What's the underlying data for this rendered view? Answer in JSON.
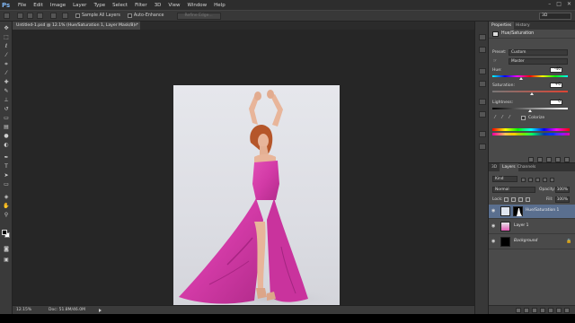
{
  "menubar": {
    "logo": "Ps",
    "items": [
      "File",
      "Edit",
      "Image",
      "Layer",
      "Type",
      "Select",
      "Filter",
      "3D",
      "View",
      "Window",
      "Help"
    ],
    "window_controls": [
      "–",
      "□",
      "✕"
    ]
  },
  "optionsbar": {
    "sample_all_layers": "Sample All Layers",
    "auto_enhance": "Auto-Enhance",
    "refine_edge": "Refine Edge...",
    "workspace": "3D"
  },
  "document": {
    "tab_title": "Untitled-1.psd @ 12.1% (Hue/Saturation 1, Layer Mask/8) *",
    "tab_close": "×"
  },
  "statusbar": {
    "zoom": "12.15%",
    "doc_size": "Doc: 51.8M/46.0M"
  },
  "properties": {
    "tabs": [
      "Properties",
      "History"
    ],
    "title": "Hue/Saturation",
    "preset_label": "Preset:",
    "preset_value": "Custom",
    "channel_value": "Master",
    "hue_label": "Hue:",
    "hue_value": "-46",
    "saturation_label": "Saturation:",
    "saturation_value": "+6",
    "lightness_label": "Lightness:",
    "lightness_value": "0",
    "colorize_label": "Colorize",
    "levels": {
      "hue": 0.38,
      "saturation": 0.52,
      "lightness": 0.5
    }
  },
  "layers": {
    "tabs": [
      "3D",
      "Layers",
      "Channels"
    ],
    "kind_filter": "Kind",
    "blend_mode": "Normal",
    "opacity_label": "Opacity:",
    "opacity_value": "100%",
    "lock_label": "Lock:",
    "fill_label": "Fill:",
    "fill_value": "100%",
    "items": [
      {
        "name": "Hue/Saturation 1",
        "selected": true
      },
      {
        "name": "Layer 1",
        "selected": false
      },
      {
        "name": "Background",
        "selected": false
      }
    ]
  },
  "colors": {
    "dress": "#d63aa8",
    "selection": "#5a6f8f",
    "hair": "#b5562a",
    "skin": "#e8b59a"
  }
}
